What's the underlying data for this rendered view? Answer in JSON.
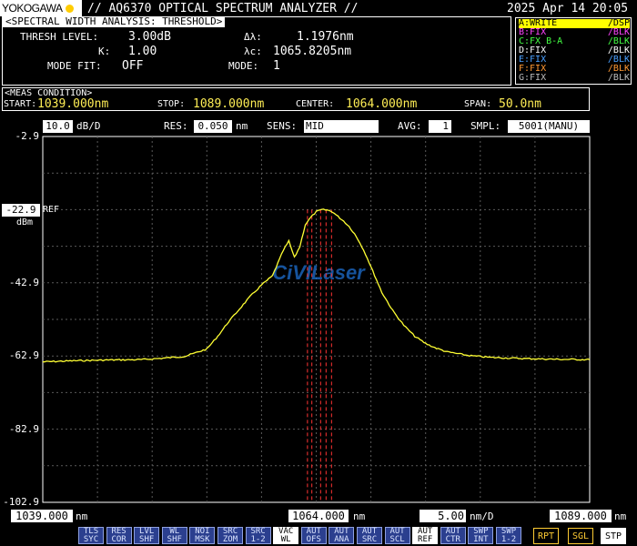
{
  "header": {
    "brand": "YOKOGAWA",
    "title": "// AQ6370 OPTICAL SPECTRUM ANALYZER //",
    "datetime": "2025 Apr 14 20:05"
  },
  "analysis": {
    "heading": "<SPECTRAL WIDTH ANALYSIS: THRESHOLD>",
    "thresh_label": "THRESH LEVEL:",
    "thresh_value": "3.00dB",
    "k_label": "K:",
    "k_value": "1.00",
    "modefit_label": "MODE FIT:",
    "modefit_value": "OFF",
    "dl_label": "Δλ:",
    "dl_value": "1.1976nm",
    "lc_label": "λc:",
    "lc_value": "1065.8205nm",
    "mode_label": "MODE:",
    "mode_value": "1"
  },
  "traces": [
    {
      "left": "A:WRITE",
      "right": "/DSP",
      "color": "#ffff00",
      "highlight": true
    },
    {
      "left": "B:FIX",
      "right": "/BLK",
      "color": "#ff44ff",
      "highlight": false
    },
    {
      "left": "C:FX B-A",
      "right": "/BLK",
      "color": "#44ff44",
      "highlight": false
    },
    {
      "left": "D:FIX",
      "right": "/BLK",
      "color": "#ffffff",
      "highlight": false
    },
    {
      "left": "E:FIX",
      "right": "/BLK",
      "color": "#4aa0ff",
      "highlight": false
    },
    {
      "left": "F:FIX",
      "right": "/BLK",
      "color": "#ff9933",
      "highlight": false
    },
    {
      "left": "G:FIX",
      "right": "/BLK",
      "color": "#bbbbbb",
      "highlight": false
    }
  ],
  "meas": {
    "heading": "<MEAS CONDITION>",
    "start_label": "START:",
    "start_value": "1039.000nm",
    "stop_label": "STOP:",
    "stop_value": "1089.000nm",
    "center_label": "CENTER:",
    "center_value": "1064.000nm",
    "span_label": "SPAN:",
    "span_value": "50.0nm"
  },
  "settings": {
    "scale_value": "10.0",
    "scale_unit": "dB/D",
    "res_label": "RES:",
    "res_value": "0.050",
    "res_unit": "nm",
    "sens_label": "SENS:",
    "sens_value": "MID",
    "avg_label": "AVG:",
    "avg_value": "1",
    "smpl_label": "SMPL:",
    "smpl_value": "5001(MANU)"
  },
  "axis": {
    "y_ticks": [
      "-2.9",
      "-22.9",
      "-42.9",
      "-62.9",
      "-82.9",
      "-102.9"
    ],
    "ref_label": "REF",
    "unit_label": "dBm",
    "x_start": "1039.000",
    "x_center": "1064.000",
    "x_stop": "1089.000",
    "x_unit": "nm",
    "div_value": "5.00",
    "div_unit": "nm/D"
  },
  "watermark": "CiVILaser",
  "softkeys": [
    [
      "TLS",
      "SYC"
    ],
    [
      "RES",
      "COR"
    ],
    [
      "LVL",
      "SHF"
    ],
    [
      "WL",
      "SHF"
    ],
    [
      "NOI",
      "MSK"
    ],
    [
      "SRC",
      "ZOM"
    ],
    [
      "SRC",
      "1-2"
    ],
    [
      "VAC",
      "WL"
    ],
    [
      "AUT",
      "OFS"
    ],
    [
      "AUT",
      "ANA"
    ],
    [
      "AUT",
      "SRC"
    ],
    [
      "AUT",
      "SCL"
    ],
    [
      "AUT",
      "REF"
    ],
    [
      "AUT",
      "CTR"
    ],
    [
      "SWP",
      "INT"
    ],
    [
      "SWP",
      "1-2"
    ]
  ],
  "softkey_active_index": [
    7,
    12
  ],
  "right_keys": [
    "RPT",
    "SGL",
    "STP"
  ],
  "colors": {
    "trace": "#ffff33",
    "markers": "#ff3333",
    "grid": "#5a5a5a",
    "softkey_bg": "#2b3f8f",
    "watermark": "#1e6fd0"
  },
  "chart_data": {
    "type": "line",
    "title": "",
    "xlabel": "nm",
    "ylabel": "dBm",
    "xlim": [
      1039.0,
      1089.0
    ],
    "ylim": [
      -102.9,
      -2.9
    ],
    "x_div": 5.0,
    "y_div": 10.0,
    "grid": true,
    "series": [
      {
        "name": "A:WRITE",
        "x": [
          1039.0,
          1042.0,
          1045.0,
          1048.0,
          1050.0,
          1052.0,
          1054.0,
          1055.0,
          1056.0,
          1057.0,
          1058.0,
          1059.0,
          1060.0,
          1060.5,
          1061.0,
          1061.5,
          1062.0,
          1062.5,
          1063.0,
          1063.5,
          1064.0,
          1064.5,
          1065.0,
          1065.5,
          1066.0,
          1066.5,
          1067.0,
          1067.5,
          1068.0,
          1068.5,
          1069.0,
          1070.0,
          1071.0,
          1072.0,
          1073.0,
          1074.0,
          1075.0,
          1076.0,
          1078.0,
          1080.0,
          1083.0,
          1086.0,
          1089.0
        ],
        "y": [
          -64.5,
          -64.2,
          -64.0,
          -63.9,
          -63.5,
          -63.0,
          -61.0,
          -57.5,
          -53.5,
          -50.0,
          -46.5,
          -43.5,
          -41.0,
          -37.5,
          -34.0,
          -31.5,
          -36.0,
          -33.0,
          -27.0,
          -25.0,
          -23.5,
          -22.9,
          -23.0,
          -23.5,
          -24.8,
          -26.0,
          -27.5,
          -29.5,
          -32.0,
          -35.0,
          -38.5,
          -45.5,
          -50.5,
          -54.5,
          -57.5,
          -59.5,
          -60.8,
          -61.8,
          -62.8,
          -63.3,
          -63.6,
          -63.8,
          -63.9
        ]
      }
    ],
    "markers_x": [
      1063.2,
      1063.6,
      1064.4,
      1064.9,
      1065.4
    ]
  }
}
